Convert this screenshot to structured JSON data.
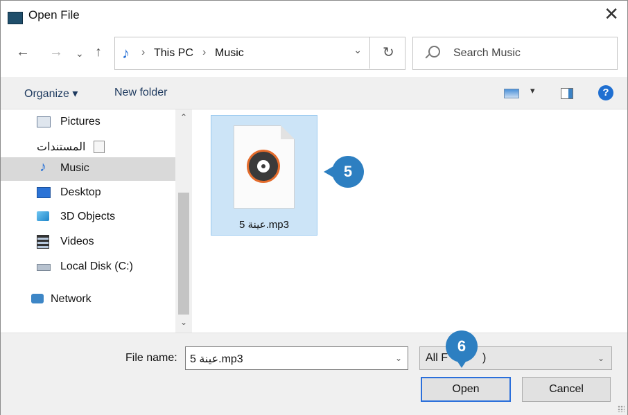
{
  "window": {
    "title": "Open File",
    "close_glyph": "✕"
  },
  "nav_buttons": {
    "back": "←",
    "forward": "→",
    "recent": "⌄",
    "up": "↑"
  },
  "address": {
    "crumbs": [
      "This PC",
      "Music"
    ],
    "separator": "›",
    "dropdown": "⌄",
    "refresh": "↻"
  },
  "search": {
    "placeholder": "Search Music"
  },
  "toolbar": {
    "organize": "Organize ▾",
    "new_folder": "New folder",
    "view_dropdown": "▾",
    "help": "?"
  },
  "sidebar": {
    "items": [
      {
        "label": "Pictures",
        "icon": "pictures-icon"
      },
      {
        "label": "المستندات",
        "icon": "documents-icon"
      },
      {
        "label": "Music",
        "icon": "music-note-icon",
        "selected": true
      },
      {
        "label": "Desktop",
        "icon": "desktop-icon"
      },
      {
        "label": "3D Objects",
        "icon": "3d-objects-icon"
      },
      {
        "label": "Videos",
        "icon": "videos-icon"
      },
      {
        "label": "Local Disk (C:)",
        "icon": "local-disk-icon"
      },
      {
        "label": "Network",
        "icon": "network-icon"
      }
    ],
    "scroll_up": "⌃",
    "scroll_down": "⌄"
  },
  "files": [
    {
      "name": "5 عينة.mp3",
      "icon": "music-file-icon",
      "selected": true
    }
  ],
  "callouts": {
    "step5": "5",
    "step6": "6"
  },
  "bottom": {
    "filename_label": "File name:",
    "filename_value": "5 عينة.mp3",
    "filetype_value": "All F",
    "filetype_tail": ")",
    "open_label": "Open",
    "cancel_label": "Cancel"
  },
  "colors": {
    "accent": "#2d7fc1",
    "selection": "#cce4f7",
    "primary_border": "#2a6fdb"
  }
}
